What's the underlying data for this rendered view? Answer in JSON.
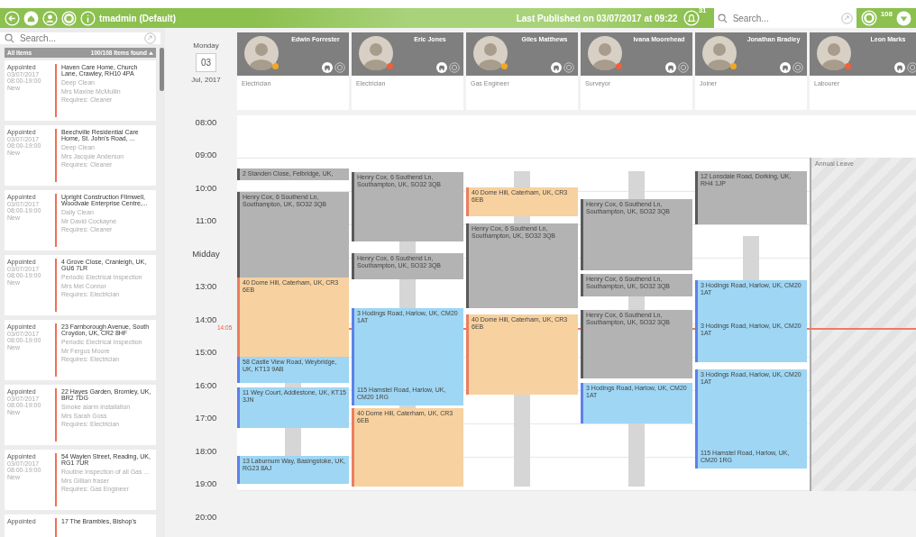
{
  "top_bar": {
    "user": "tmadmin (Default)",
    "published": "Last Published on 03/07/2017 at 09:22",
    "notifications": "31",
    "search": {
      "placeholder": "Search..."
    },
    "count": "108"
  },
  "sidebar": {
    "search": {
      "placeholder": "Search..."
    },
    "filter": "All Items",
    "found": "100/108 Items found",
    "jobs": [
      {
        "status": "Appointed",
        "date": "03/07/2017",
        "time": "08:00-19:00",
        "stage": "New",
        "address": "Haven Care Home, Church Lane, Crawley, RH10 4PA",
        "service": "Deep Clean",
        "customer": "Mrs Maxine McMullin",
        "requires": "Requires: Cleaner"
      },
      {
        "status": "Appointed",
        "date": "03/07/2017",
        "time": "08:00-19:00",
        "stage": "New",
        "address": "Beechville Residential Care Home, St. John's Road, ...",
        "service": "Deep Clean",
        "customer": "Mrs Jacquie Anderson",
        "requires": "Requires: Cleaner"
      },
      {
        "status": "Appointed",
        "date": "03/07/2017",
        "time": "08:00-19:00",
        "stage": "New",
        "address": "Upright Construction Flimwell, Woodvale Enterprise Centre,...",
        "service": "Daily Clean",
        "customer": "Mr David Cockayne",
        "requires": "Requires: Cleaner"
      },
      {
        "status": "Appointed",
        "date": "03/07/2017",
        "time": "08:00-19:00",
        "stage": "New",
        "address": "4 Grove Close, Cranleigh, UK, GU6 7LR",
        "service": "Periodic Electrical Inspection",
        "customer": "Mrs Mel Connor",
        "requires": "Requires: Electrician"
      },
      {
        "status": "Appointed",
        "date": "03/07/2017",
        "time": "08:00-19:00",
        "stage": "New",
        "address": "23 Farnborough Avenue, South Croydon, UK, CR2 8HF",
        "service": "Periodic Electrical Inspection",
        "customer": "Mr Fergus Moore",
        "requires": "Requires: Electrician"
      },
      {
        "status": "Appointed",
        "date": "03/07/2017",
        "time": "08:00-19:00",
        "stage": "New",
        "address": "22 Hayes Garden, Bromley, UK, BR2 7DG",
        "service": "Smoke alarm installation",
        "customer": "Mrs Sarah Goss",
        "requires": "Requires: Electrician"
      },
      {
        "status": "Appointed",
        "date": "03/07/2017",
        "time": "08:00-19:00",
        "stage": "New",
        "address": "54 Waylen Street, Reading, UK, RG1 7UR",
        "service": "Routine Inspection of all Gas ...",
        "customer": "Mrs Gillian fraser",
        "requires": "Requires: Gas Engineer"
      },
      {
        "status": "Appointed",
        "address": "17 The Brambles, Bishop's"
      }
    ]
  },
  "day": {
    "weekday": "Monday",
    "date": "03",
    "month": "Jul, 2017"
  },
  "hours": [
    "08:00",
    "09:00",
    "10:00",
    "11:00",
    "Midday",
    "13:00",
    "14:00",
    "15:00",
    "16:00",
    "17:00",
    "18:00",
    "19:00",
    "20:00"
  ],
  "now": "14:05",
  "resources": [
    {
      "name": "Edwin Forrester",
      "role": "Electrician",
      "color": "#f5a623",
      "events": [
        {
          "text": "2 Standen Close, Felbridge, UK,",
          "color": "#b3b3b3"
        },
        {
          "text": "Henry Cox, 6 Southend Ln, Southampton, UK, SO32 3QB",
          "color": "#b3b3b3"
        },
        {
          "text": "40 Dome Hill, Caterham, UK, CR3 6EB",
          "color": "#f7d19f"
        },
        {
          "text": "58 Castle View Road, Weybridge, UK, KT13 9AB",
          "color": "#9ed6f4"
        },
        {
          "text": "11 Wey Court, Addlestone, UK, KT15 3JN",
          "color": "#9ed6f4"
        },
        {
          "text": "13 Laburnum Way, Basingstoke, UK, RG23 8AJ",
          "color": "#9ed6f4"
        }
      ]
    },
    {
      "name": "Eric Jones",
      "role": "Electrician",
      "color": "#f0603c",
      "events": [
        {
          "text": "Henry Cox, 6 Southend Ln, Southampton, UK, SO32 3QB",
          "color": "#b3b3b3"
        },
        {
          "text": "Henry Cox, 6 Southend Ln, Southampton, UK, SO32 3QB",
          "color": "#b3b3b3"
        },
        {
          "text": "3 Hodings Road, Harlow, UK, CM20 1AT",
          "color": "#9ed6f4"
        },
        {
          "text": "115 Hamstel Road, Harlow, UK, CM20 1RG",
          "color": "#9ed6f4"
        },
        {
          "text": "40 Dome Hill, Caterham, UK, CR3 6EB",
          "color": "#f7d19f"
        }
      ]
    },
    {
      "name": "Giles Matthews",
      "role": "Gas Engineer",
      "color": "#f5a623",
      "events": [
        {
          "text": "40 Dome Hill, Caterham, UK, CR3 6EB",
          "color": "#f7d19f"
        },
        {
          "text": "Henry Cox, 6 Southend Ln, Southampton, UK, SO32 3QB",
          "color": "#b3b3b3"
        },
        {
          "text": "40 Dome Hill, Caterham, UK, CR3 6EB",
          "color": "#f7d19f"
        }
      ]
    },
    {
      "name": "Ivana Moorehead",
      "role": "Surveyor",
      "color": "#f0603c",
      "events": [
        {
          "text": "Henry Cox, 6 Southend Ln, Southampton, UK, SO32 3QB",
          "color": "#b3b3b3"
        },
        {
          "text": "Henry Cox, 6 Southend Ln, Southampton, UK, SO32 3QB",
          "color": "#b3b3b3"
        },
        {
          "text": "Henry Cox, 6 Southend Ln, Southampton, UK, SO32 3QB",
          "color": "#b3b3b3"
        },
        {
          "text": "3 Hodings Road, Harlow, UK, CM20 1AT",
          "color": "#9ed6f4"
        }
      ]
    },
    {
      "name": "Jonathan Bradley",
      "role": "Joiner",
      "color": "#f5a623",
      "events": [
        {
          "text": "12 Lonsdale Road, Dorking, UK, RH4 1JP",
          "color": "#b3b3b3"
        },
        {
          "text": "3 Hodings Road, Harlow, UK, CM20 1AT",
          "color": "#9ed6f4"
        },
        {
          "text": "3 Hodings Road, Harlow, UK, CM20 1AT",
          "color": "#9ed6f4"
        },
        {
          "text": "3 Hodings Road, Harlow, UK, CM20 1AT",
          "color": "#9ed6f4"
        },
        {
          "text": "115 Hamstel Road, Harlow, UK, CM20 1RG",
          "color": "#9ed6f4"
        }
      ]
    },
    {
      "name": "Leon Marks",
      "role": "Labourer",
      "color": "#f0603c",
      "absence": "Annual Leave"
    }
  ]
}
